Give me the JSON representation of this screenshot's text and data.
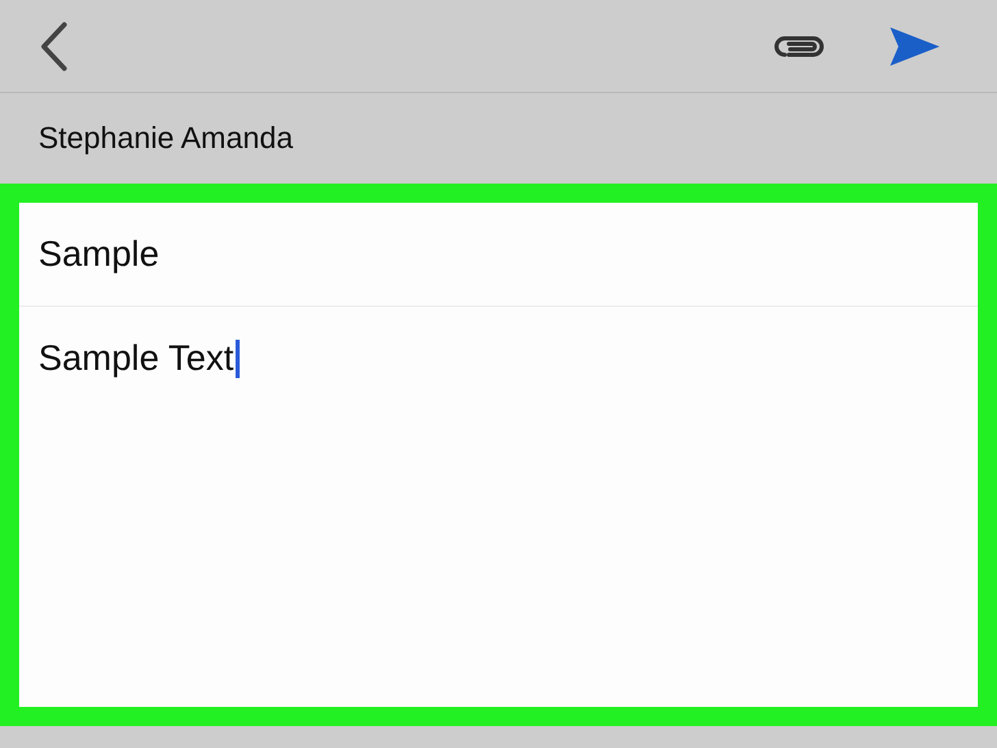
{
  "recipient": "Stephanie Amanda",
  "compose": {
    "highlighted": true,
    "subject": "Sample",
    "body": "Sample Text",
    "body_focused": true
  }
}
